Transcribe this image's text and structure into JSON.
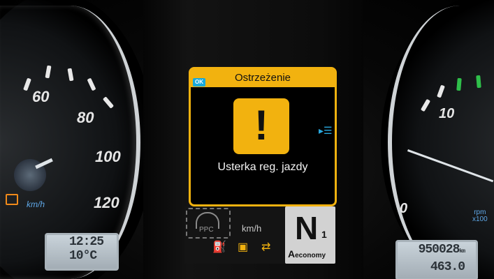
{
  "speedometer": {
    "labels": [
      "60",
      "80",
      "100",
      "120"
    ],
    "unit": "km/h"
  },
  "clock_display": {
    "time": "12:25",
    "temperature": "10°C"
  },
  "warning_screen": {
    "ok_badge": "OK",
    "title": "Ostrzeżenie",
    "warning_symbol": "!",
    "message": "Usterka reg. jazdy",
    "accent_color": "#f2b20f"
  },
  "lower_panel": {
    "ppc_label": "PPC",
    "speed_unit": "km/h",
    "gear": "N",
    "gear_number": "1",
    "mode_letter": "A",
    "mode_name": "economy",
    "icons": [
      "fuel-icon",
      "adblue-icon",
      "transmission-icon"
    ]
  },
  "tachometer": {
    "label": "10",
    "zero_label": "0",
    "unit_top": "rpm",
    "unit_bottom": "x100"
  },
  "odometer": {
    "total": "950028",
    "total_unit": "km",
    "trip": "463.0"
  }
}
